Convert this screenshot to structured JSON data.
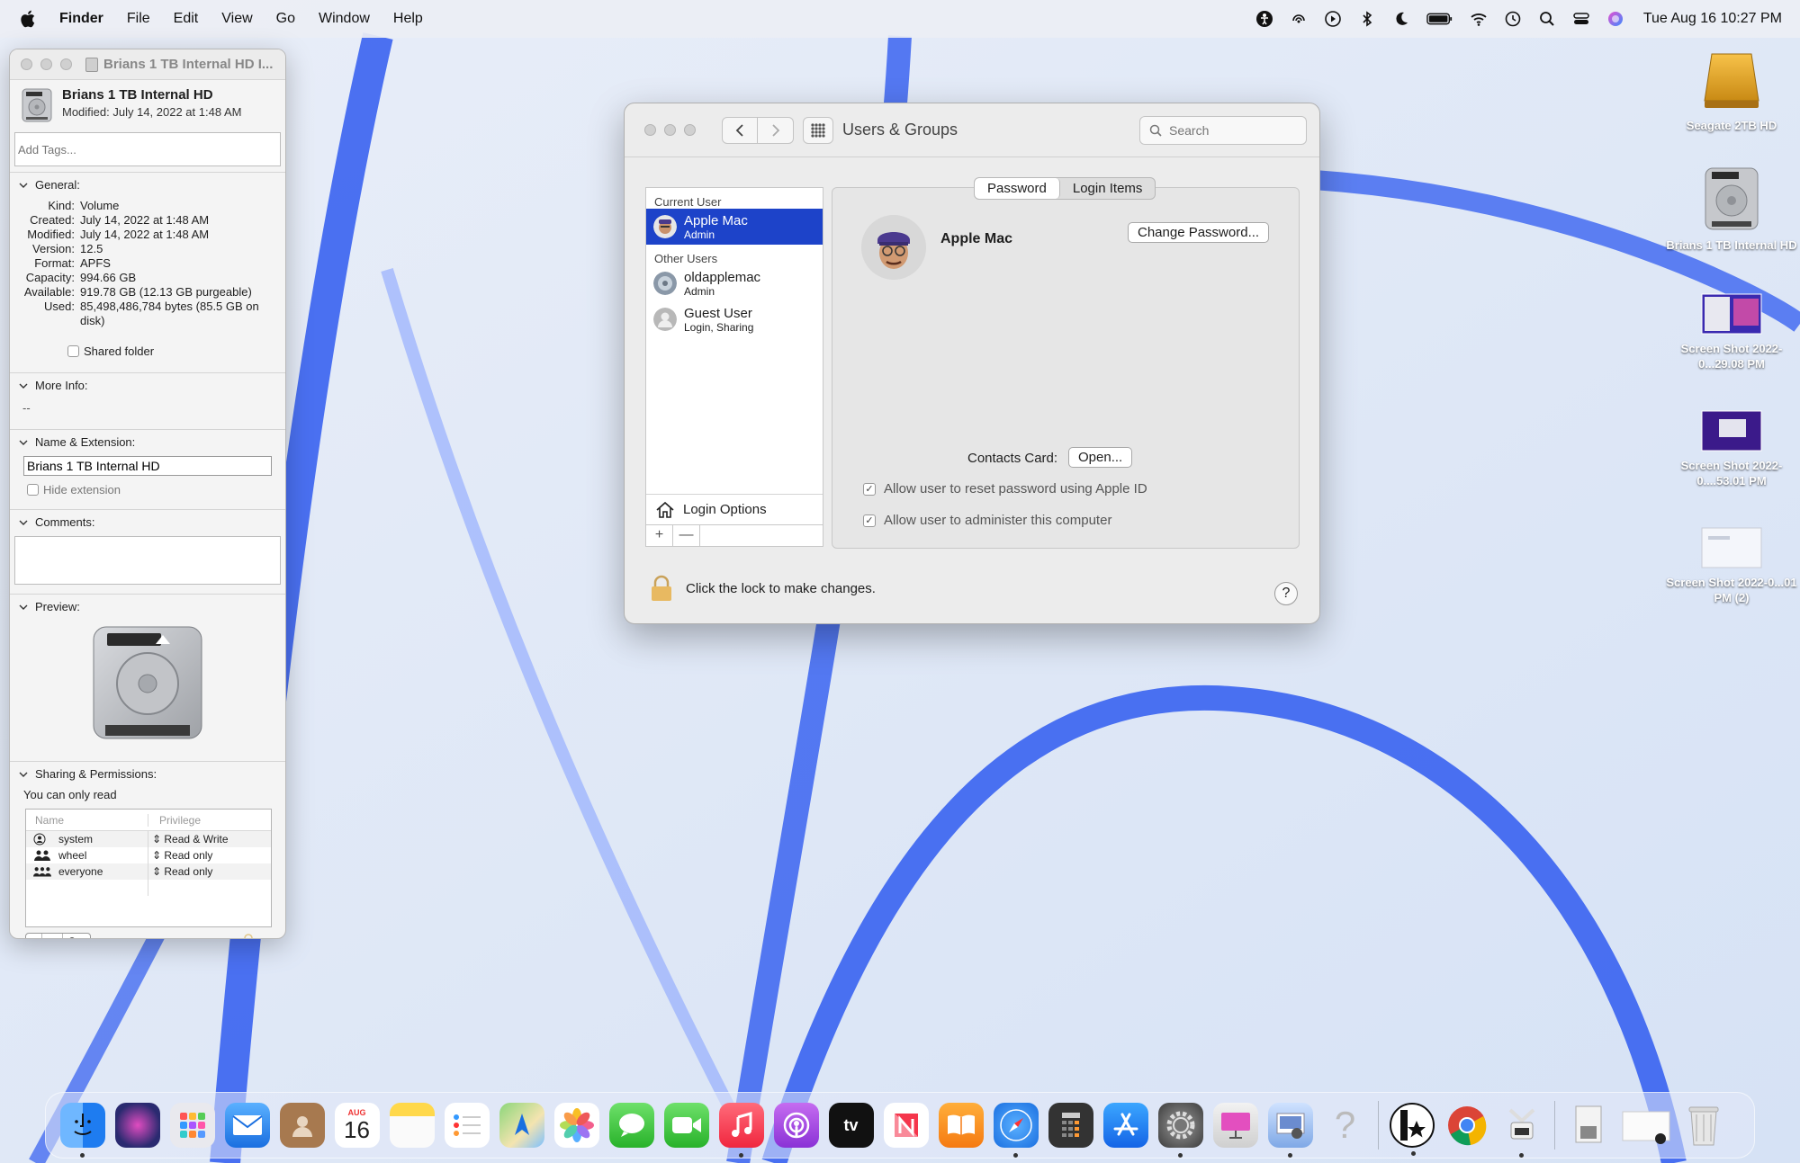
{
  "menubar": {
    "app_name": "Finder",
    "items": [
      "File",
      "Edit",
      "View",
      "Go",
      "Window",
      "Help"
    ],
    "clock": "Tue Aug 16  10:27 PM"
  },
  "info_window": {
    "title": "Brians 1 TB Internal HD I...",
    "name": "Brians 1 TB Internal HD",
    "modified_line": "Modified: July 14, 2022 at 1:48 AM",
    "tags_placeholder": "Add Tags...",
    "general": {
      "header": "General:",
      "rows": [
        {
          "k": "Kind:",
          "v": "Volume"
        },
        {
          "k": "Created:",
          "v": "July 14, 2022 at 1:48 AM"
        },
        {
          "k": "Modified:",
          "v": "July 14, 2022 at 1:48 AM"
        },
        {
          "k": "Version:",
          "v": "12.5"
        },
        {
          "k": "Format:",
          "v": "APFS"
        },
        {
          "k": "Capacity:",
          "v": "994.66 GB"
        },
        {
          "k": "Available:",
          "v": "919.78 GB (12.13 GB purgeable)"
        },
        {
          "k": "Used:",
          "v": "85,498,486,784 bytes (85.5 GB on disk)"
        }
      ],
      "shared_folder": "Shared folder"
    },
    "more_info": {
      "header": "More Info:",
      "value": "--"
    },
    "name_ext": {
      "header": "Name & Extension:",
      "value": "Brians 1 TB Internal HD",
      "hide_extension": "Hide extension"
    },
    "comments": {
      "header": "Comments:"
    },
    "preview": {
      "header": "Preview:"
    },
    "sharing": {
      "header": "Sharing & Permissions:",
      "note": "You can only read",
      "col_name": "Name",
      "col_privilege": "Privilege",
      "rows": [
        {
          "name": "system",
          "privilege": "Read & Write"
        },
        {
          "name": "wheel",
          "privilege": "Read only"
        },
        {
          "name": "everyone",
          "privilege": "Read only"
        }
      ],
      "buttons": [
        "+",
        "—",
        "⊙⌄"
      ]
    }
  },
  "users_groups": {
    "title": "Users & Groups",
    "search_placeholder": "Search",
    "current_user_header": "Current User",
    "other_users_header": "Other Users",
    "users": [
      {
        "name": "Apple Mac",
        "role": "Admin"
      },
      {
        "name": "oldapplemac",
        "role": "Admin"
      },
      {
        "name": "Guest User",
        "role": "Login, Sharing"
      }
    ],
    "login_options": "Login Options",
    "list_buttons": [
      "+",
      "—"
    ],
    "tabs": [
      "Password",
      "Login Items"
    ],
    "detail_user": "Apple Mac",
    "change_password": "Change Password...",
    "contacts_card": "Contacts Card:",
    "open_button": "Open...",
    "allow_reset": "Allow user to reset password using Apple ID",
    "allow_admin": "Allow user to administer this computer",
    "lock_text": "Click the lock to make changes.",
    "help": "?"
  },
  "desktop_icons": [
    {
      "label": "Seagate 2TB HD"
    },
    {
      "label": "Brians 1 TB Internal HD"
    },
    {
      "label": "Screen Shot 2022-0...29.08 PM"
    },
    {
      "label": "Screen Shot 2022-0....53.01 PM"
    },
    {
      "label": "Screen Shot 2022-0...01 PM (2)"
    }
  ],
  "dock": {
    "calendar_month": "AUG",
    "calendar_day": "16",
    "tv_label": "tv",
    "apps": [
      "Finder",
      "Siri",
      "Launchpad",
      "Mail",
      "Contacts",
      "Calendar",
      "Notes",
      "Reminders",
      "Maps",
      "Photos",
      "Messages",
      "FaceTime",
      "Music",
      "Podcasts",
      "TV",
      "News",
      "Books",
      "Safari",
      "Calculator",
      "App Store",
      "System Preferences",
      "Keynote",
      "Preview",
      "Unknown",
      "Instruments",
      "Chrome",
      "Utility",
      "Document",
      "Folder",
      "Trash"
    ]
  },
  "colors": {
    "selection": "#1d43c9",
    "wallpaper_blue": "#2f5bf0"
  }
}
